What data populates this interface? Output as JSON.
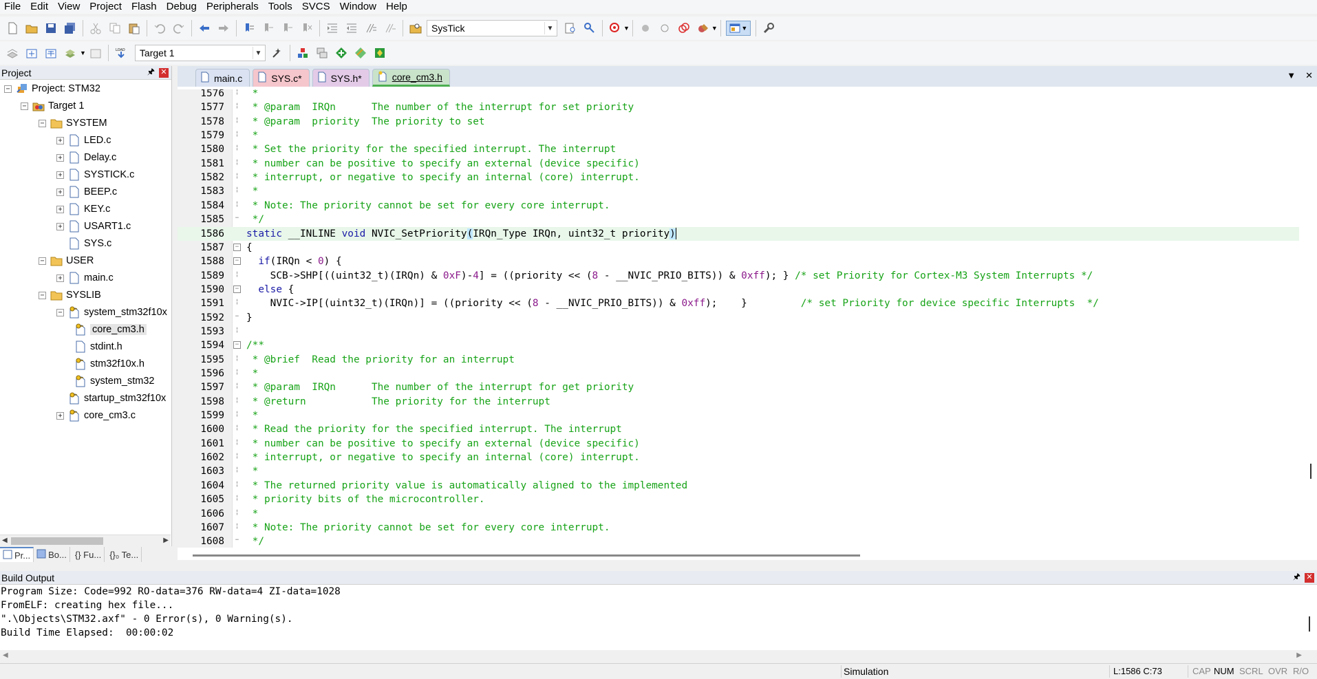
{
  "menu": [
    "File",
    "Edit",
    "View",
    "Project",
    "Flash",
    "Debug",
    "Peripherals",
    "Tools",
    "SVCS",
    "Window",
    "Help"
  ],
  "toolbar": {
    "find_combo": "SysTick",
    "target_combo": "Target 1"
  },
  "project_panel": {
    "title": "Project",
    "tree": [
      {
        "label": "Project: STM32",
        "level": 0,
        "icon": "project",
        "expander": "minus"
      },
      {
        "label": "Target 1",
        "level": 1,
        "icon": "target",
        "expander": "minus"
      },
      {
        "label": "SYSTEM",
        "level": 2,
        "icon": "folder",
        "expander": "minus"
      },
      {
        "label": "LED.c",
        "level": 3,
        "icon": "file",
        "expander": "plus"
      },
      {
        "label": "Delay.c",
        "level": 3,
        "icon": "file",
        "expander": "plus"
      },
      {
        "label": "SYSTICK.c",
        "level": 3,
        "icon": "file",
        "expander": "plus"
      },
      {
        "label": "BEEP.c",
        "level": 3,
        "icon": "file",
        "expander": "plus"
      },
      {
        "label": "KEY.c",
        "level": 3,
        "icon": "file",
        "expander": "plus"
      },
      {
        "label": "USART1.c",
        "level": 3,
        "icon": "file",
        "expander": "plus"
      },
      {
        "label": "SYS.c",
        "level": 3,
        "icon": "file",
        "expander": "none"
      },
      {
        "label": "USER",
        "level": 2,
        "icon": "folder",
        "expander": "minus"
      },
      {
        "label": "main.c",
        "level": 3,
        "icon": "file",
        "expander": "plus"
      },
      {
        "label": "SYSLIB",
        "level": 2,
        "icon": "folder",
        "expander": "minus"
      },
      {
        "label": "system_stm32f10x",
        "level": 3,
        "icon": "keyfile",
        "expander": "minus"
      },
      {
        "label": "core_cm3.h",
        "level": 4,
        "icon": "keyfile",
        "expander": "none",
        "selected": true
      },
      {
        "label": "stdint.h",
        "level": 4,
        "icon": "file",
        "expander": "none"
      },
      {
        "label": "stm32f10x.h",
        "level": 4,
        "icon": "keyfile",
        "expander": "none"
      },
      {
        "label": "system_stm32",
        "level": 4,
        "icon": "keyfile",
        "expander": "none"
      },
      {
        "label": "startup_stm32f10x",
        "level": 3,
        "icon": "keyfile",
        "expander": "none"
      },
      {
        "label": "core_cm3.c",
        "level": 3,
        "icon": "keyfile",
        "expander": "plus"
      }
    ],
    "bottom_tabs": [
      "Pr...",
      "Bo...",
      "{} Fu...",
      "{}₀ Te..."
    ]
  },
  "editor": {
    "tabs": [
      {
        "label": "main.c",
        "cls": "t-main"
      },
      {
        "label": "SYS.c*",
        "cls": "t-sysc"
      },
      {
        "label": "SYS.h*",
        "cls": "t-sysh"
      },
      {
        "label": "core_cm3.h",
        "cls": "t-core",
        "active": true
      }
    ],
    "lines": [
      {
        "n": "1576",
        "fold": "line",
        "parts": [
          [
            "c",
            " *"
          ]
        ]
      },
      {
        "n": "1577",
        "fold": "line",
        "parts": [
          [
            "c",
            " * @param  IRQn      The number of the interrupt for set priority"
          ]
        ]
      },
      {
        "n": "1578",
        "fold": "line",
        "parts": [
          [
            "c",
            " * @param  priority  The priority to set"
          ]
        ]
      },
      {
        "n": "1579",
        "fold": "line",
        "parts": [
          [
            "c",
            " *"
          ]
        ]
      },
      {
        "n": "1580",
        "fold": "line",
        "parts": [
          [
            "c",
            " * Set the priority for the specified interrupt. The interrupt"
          ]
        ]
      },
      {
        "n": "1581",
        "fold": "line",
        "parts": [
          [
            "c",
            " * number can be positive to specify an external (device specific)"
          ]
        ]
      },
      {
        "n": "1582",
        "fold": "line",
        "parts": [
          [
            "c",
            " * interrupt, or negative to specify an internal (core) interrupt."
          ]
        ]
      },
      {
        "n": "1583",
        "fold": "line",
        "parts": [
          [
            "c",
            " *"
          ]
        ]
      },
      {
        "n": "1584",
        "fold": "line",
        "parts": [
          [
            "c",
            " * Note: The priority cannot be set for every core interrupt."
          ]
        ]
      },
      {
        "n": "1585",
        "fold": "end",
        "parts": [
          [
            "c",
            " */"
          ]
        ]
      },
      {
        "n": "1586",
        "fold": "none",
        "hl": true,
        "parts": [
          [
            "k",
            "static"
          ],
          [
            "i",
            " __INLINE "
          ],
          [
            "k",
            "void"
          ],
          [
            "i",
            " NVIC_SetPriority"
          ],
          [
            "b",
            "("
          ],
          [
            "i",
            "IRQn_Type IRQn, uint32_t priority"
          ],
          [
            "b",
            ")"
          ],
          [
            "caret",
            ""
          ]
        ]
      },
      {
        "n": "1587",
        "fold": "box",
        "parts": [
          [
            "i",
            "{"
          ]
        ]
      },
      {
        "n": "1588",
        "fold": "box",
        "parts": [
          [
            "i",
            "  "
          ],
          [
            "k",
            "if"
          ],
          [
            "i",
            "(IRQn < "
          ],
          [
            "n",
            "0"
          ],
          [
            "i",
            ") {"
          ]
        ]
      },
      {
        "n": "1589",
        "fold": "line",
        "parts": [
          [
            "i",
            "    SCB->SHP[((uint32_t)(IRQn) & "
          ],
          [
            "n",
            "0xF"
          ],
          [
            "i",
            ")-"
          ],
          [
            "n",
            "4"
          ],
          [
            "i",
            "] = ((priority << ("
          ],
          [
            "n",
            "8"
          ],
          [
            "i",
            " - __NVIC_PRIO_BITS)) & "
          ],
          [
            "n",
            "0xff"
          ],
          [
            "i",
            "); } "
          ],
          [
            "c",
            "/* set Priority for Cortex-M3 System Interrupts */"
          ]
        ]
      },
      {
        "n": "1590",
        "fold": "box",
        "parts": [
          [
            "i",
            "  "
          ],
          [
            "k",
            "else"
          ],
          [
            "i",
            " {"
          ]
        ]
      },
      {
        "n": "1591",
        "fold": "line",
        "parts": [
          [
            "i",
            "    NVIC->IP[(uint32_t)(IRQn)] = ((priority << ("
          ],
          [
            "n",
            "8"
          ],
          [
            "i",
            " - __NVIC_PRIO_BITS)) & "
          ],
          [
            "n",
            "0xff"
          ],
          [
            "i",
            ");    }         "
          ],
          [
            "c",
            "/* set Priority for device specific Interrupts  */"
          ]
        ]
      },
      {
        "n": "1592",
        "fold": "end",
        "parts": [
          [
            "i",
            "}"
          ]
        ]
      },
      {
        "n": "1593",
        "fold": "line",
        "parts": [
          [
            "i",
            ""
          ]
        ]
      },
      {
        "n": "1594",
        "fold": "box",
        "parts": [
          [
            "c",
            "/**"
          ]
        ]
      },
      {
        "n": "1595",
        "fold": "line",
        "parts": [
          [
            "c",
            " * @brief  Read the priority for an interrupt"
          ]
        ]
      },
      {
        "n": "1596",
        "fold": "line",
        "parts": [
          [
            "c",
            " *"
          ]
        ]
      },
      {
        "n": "1597",
        "fold": "line",
        "parts": [
          [
            "c",
            " * @param  IRQn      The number of the interrupt for get priority"
          ]
        ]
      },
      {
        "n": "1598",
        "fold": "line",
        "parts": [
          [
            "c",
            " * @return           The priority for the interrupt"
          ]
        ]
      },
      {
        "n": "1599",
        "fold": "line",
        "parts": [
          [
            "c",
            " *"
          ]
        ]
      },
      {
        "n": "1600",
        "fold": "line",
        "parts": [
          [
            "c",
            " * Read the priority for the specified interrupt. The interrupt"
          ]
        ]
      },
      {
        "n": "1601",
        "fold": "line",
        "parts": [
          [
            "c",
            " * number can be positive to specify an external (device specific)"
          ]
        ]
      },
      {
        "n": "1602",
        "fold": "line",
        "parts": [
          [
            "c",
            " * interrupt, or negative to specify an internal (core) interrupt."
          ]
        ]
      },
      {
        "n": "1603",
        "fold": "line",
        "parts": [
          [
            "c",
            " *"
          ]
        ]
      },
      {
        "n": "1604",
        "fold": "line",
        "parts": [
          [
            "c",
            " * The returned priority value is automatically aligned to the implemented"
          ]
        ]
      },
      {
        "n": "1605",
        "fold": "line",
        "parts": [
          [
            "c",
            " * priority bits of the microcontroller."
          ]
        ]
      },
      {
        "n": "1606",
        "fold": "line",
        "parts": [
          [
            "c",
            " *"
          ]
        ]
      },
      {
        "n": "1607",
        "fold": "line",
        "parts": [
          [
            "c",
            " * Note: The priority cannot be set for every core interrupt."
          ]
        ]
      },
      {
        "n": "1608",
        "fold": "end",
        "parts": [
          [
            "c",
            " */"
          ]
        ]
      }
    ]
  },
  "build_output": {
    "title": "Build Output",
    "lines": [
      "Program Size: Code=992 RO-data=376 RW-data=4 ZI-data=1028",
      "FromELF: creating hex file...",
      "\".\\Objects\\STM32.axf\" - 0 Error(s), 0 Warning(s).",
      "Build Time Elapsed:  00:00:02"
    ]
  },
  "status": {
    "mode": "Simulation",
    "position": "L:1586 C:73",
    "cap": "CAP",
    "num": "NUM",
    "scrl": "SCRL",
    "ovr": "OVR",
    "rw": "R/O"
  },
  "colors": {
    "comment": "#17a317",
    "keyword": "#1a1aa6",
    "number": "#8b1a8b",
    "highlight_line": "#e8f7ea"
  }
}
